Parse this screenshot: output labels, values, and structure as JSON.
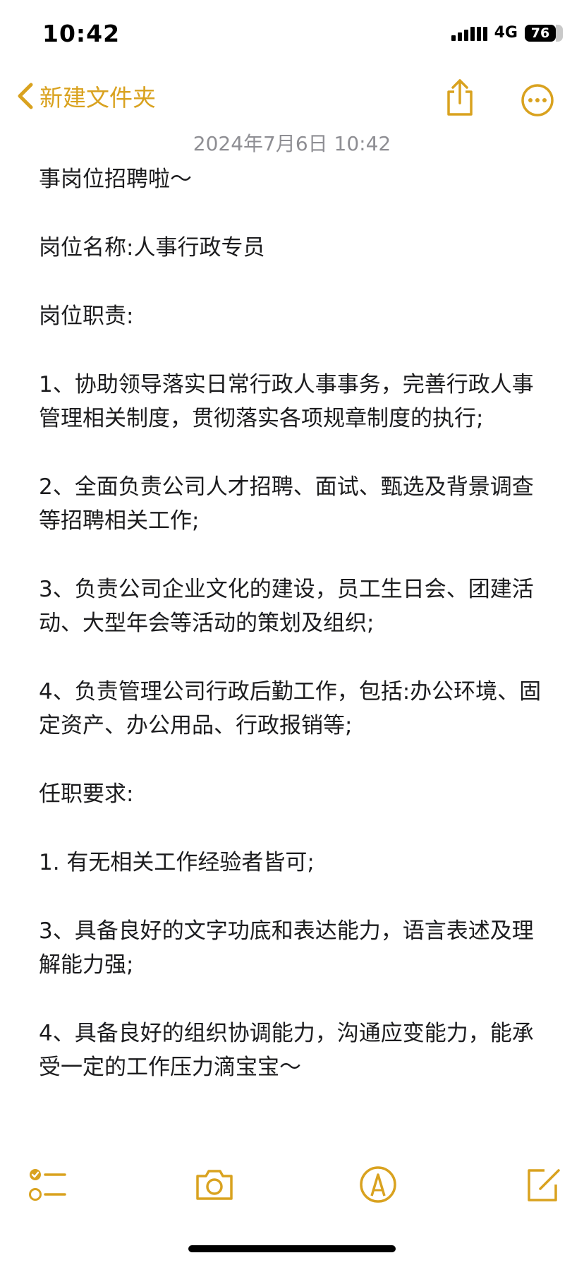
{
  "status_bar": {
    "time": "10:42",
    "network": "4G",
    "battery": "76"
  },
  "nav": {
    "back_label": "新建文件夹",
    "back_icon": "chevron-left-icon",
    "share_icon": "share-icon",
    "more_icon": "more-options-icon"
  },
  "note": {
    "date": "2024年7月6日 10:42",
    "paragraphs": [
      "事岗位招聘啦～",
      "岗位名称:人事行政专员",
      "岗位职责:",
      "1、协助领导落实日常行政人事事务，完善行政人事管理相关制度，贯彻落实各项规章制度的执行;",
      "2、全面负责公司人才招聘、面试、甄选及背景调查等招聘相关工作;",
      "3、负责公司企业文化的建设，员工生日会、团建活动、大型年会等活动的策划及组织;",
      "4、负责管理公司行政后勤工作，包括:办公环境、固定资产、办公用品、行政报销等;",
      "任职要求:",
      "1. 有无相关工作经验者皆可;",
      "3、具备良好的文字功底和表达能力，语言表述及理解能力强;",
      "4、具备良好的组织协调能力，沟通应变能力，能承受一定的工作压力滴宝宝～"
    ]
  },
  "toolbar": {
    "icons": [
      "checklist-icon",
      "camera-icon",
      "markup-icon",
      "compose-icon"
    ]
  },
  "colors": {
    "accent": "#d9a21f",
    "date_text": "#8e8e93",
    "body_text": "#1c1c1e"
  }
}
